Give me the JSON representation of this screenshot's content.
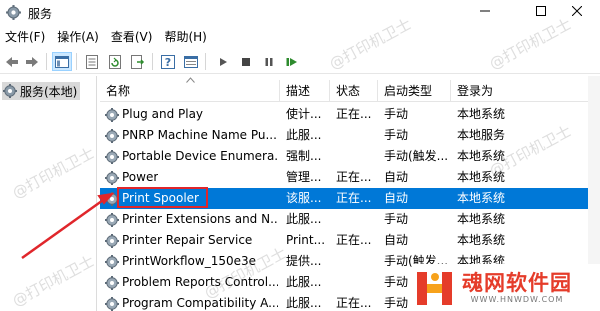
{
  "window": {
    "title": "服务"
  },
  "menu": {
    "items": [
      "文件(F)",
      "操作(A)",
      "查看(V)",
      "帮助(H)"
    ]
  },
  "tree": {
    "root_label": "服务(本地)"
  },
  "columns": [
    "名称",
    "描述",
    "状态",
    "启动类型",
    "登录为"
  ],
  "rows": [
    {
      "name": "Plug and Play",
      "desc": "使计...",
      "status": "正在...",
      "start": "手动",
      "login": "本地系统"
    },
    {
      "name": "PNRP Machine Name Pu...",
      "desc": "此服...",
      "status": "",
      "start": "手动",
      "login": "本地服务"
    },
    {
      "name": "Portable Device Enumera...",
      "desc": "强制...",
      "status": "",
      "start": "手动(触发...",
      "login": "本地系统"
    },
    {
      "name": "Power",
      "desc": "管理...",
      "status": "正在...",
      "start": "自动",
      "login": "本地系统"
    },
    {
      "name": "Print Spooler",
      "desc": "该服...",
      "status": "正在...",
      "start": "自动",
      "login": "本地系统",
      "selected": true
    },
    {
      "name": "Printer Extensions and N...",
      "desc": "此服...",
      "status": "",
      "start": "手动",
      "login": "本地系统"
    },
    {
      "name": "Printer Repair Service",
      "desc": "Print...",
      "status": "正在...",
      "start": "自动",
      "login": "本地系统"
    },
    {
      "name": "PrintWorkflow_150e3e",
      "desc": "提供...",
      "status": "",
      "start": "手动(触发...",
      "login": "本地系统"
    },
    {
      "name": "Problem Reports Control...",
      "desc": "此服...",
      "status": "",
      "start": "手动",
      "login": "本地系统"
    },
    {
      "name": "Program Compatibility A...",
      "desc": "此服...",
      "status": "正在...",
      "start": "手动",
      "login": "本地系统"
    }
  ],
  "watermark": {
    "text": "@打印机卫士"
  },
  "logo": {
    "cn": "魂网软件园",
    "en": "WWW.HNWDW.COM"
  },
  "colors": {
    "selection": "#0078d7",
    "highlight_box": "#e0262b",
    "arrow": "#e0262b",
    "logo_red": "#e53c2a",
    "logo_orange": "#f7a21b"
  },
  "icons": [
    "services-gear-icon",
    "minimize-icon",
    "maximize-icon",
    "close-icon",
    "back-icon",
    "forward-icon",
    "show-tree-icon",
    "properties-icon",
    "refresh-icon",
    "export-icon",
    "help-icon",
    "console-icon",
    "start-icon",
    "stop-icon",
    "pause-icon",
    "restart-icon"
  ]
}
